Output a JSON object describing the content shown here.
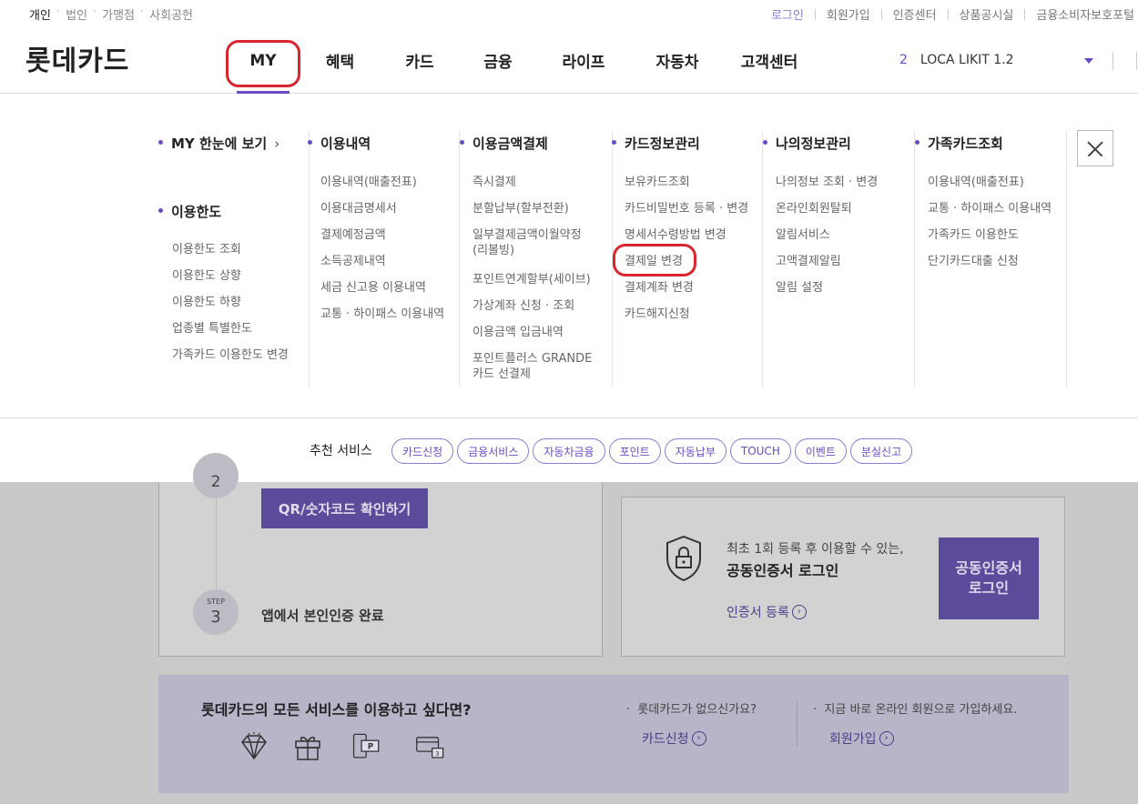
{
  "util": {
    "left": [
      "개인",
      "법인",
      "가맹점",
      "사회공헌"
    ],
    "right": [
      "로그인",
      "회원가입",
      "인증센터",
      "상품공시실",
      "금융소비자보호포털"
    ]
  },
  "logo": "롯데카드",
  "nav": [
    "MY",
    "혜택",
    "카드",
    "금융",
    "라이프",
    "자동차",
    "고객센터"
  ],
  "account": {
    "num": "2",
    "name": "LOCA LIKIT 1.2"
  },
  "menu": {
    "col1": {
      "title": "MY 한눈에 보기",
      "title2": "이용한도",
      "items": [
        "이용한도 조회",
        "이용한도 상향",
        "이용한도 하향",
        "업종별 특별한도",
        "가족카드 이용한도 변경"
      ]
    },
    "col2": {
      "title": "이용내역",
      "items": [
        "이용내역(매출전표)",
        "이용대금명세서",
        "결제예정금액",
        "소득공제내역",
        "세금 신고용 이용내역",
        "교통 · 하이패스 이용내역"
      ]
    },
    "col3": {
      "title": "이용금액결제",
      "items": [
        "즉시결제",
        "분할납부(할부전환)",
        "일부결제금액이월약정(리볼빙)",
        "포인트연계할부(세이브)",
        "가상계좌 신청 · 조회",
        "이용금액 입금내역",
        "포인트플러스 GRANDE카드 선결제"
      ]
    },
    "col4": {
      "title": "카드정보관리",
      "items": [
        "보유카드조회",
        "카드비밀번호 등록 · 변경",
        "명세서수령방법 변경",
        "결제일 변경",
        "결제계좌 변경",
        "카드해지신청"
      ]
    },
    "col5": {
      "title": "나의정보관리",
      "items": [
        "나의정보 조회 · 변경",
        "온라인회원탈퇴",
        "알림서비스",
        "고액결제알림",
        "알림 설정"
      ]
    },
    "col6": {
      "title": "가족카드조회",
      "items": [
        "이용내역(매출전표)",
        "교통 · 하이패스 이용내역",
        "가족카드 이용한도",
        "단기카드대출 신청"
      ]
    }
  },
  "reco": {
    "label": "추천 서비스",
    "tags": [
      "카드신청",
      "금융서비스",
      "자동차금융",
      "포인트",
      "자동납부",
      "TOUCH",
      "이벤트",
      "분실신고"
    ]
  },
  "steps": {
    "step2_num": "2",
    "qr_button": "QR/숫자코드 확인하기",
    "step3_label": "STEP",
    "step3_num": "3",
    "step3_text": "앱에서 본인인증 완료"
  },
  "cert": {
    "sub": "최초 1회 등록 후 이용할 수 있는,",
    "title": "공동인증서 로그인",
    "link": "인증서 등록",
    "button_line1": "공동인증서",
    "button_line2": "로그인"
  },
  "banner": {
    "title": "롯데카드의 모든 서비스를 이용하고 싶다면?",
    "q1": "롯데카드가 없으신가요?",
    "link1": "카드신청",
    "q2": "지금 바로 온라인 회원으로 가입하세요.",
    "link2": "회원가입"
  },
  "colors": {
    "accent": "#6a4bc4",
    "highlight": "#d8262f",
    "tag_border": "#8c7bd0"
  }
}
